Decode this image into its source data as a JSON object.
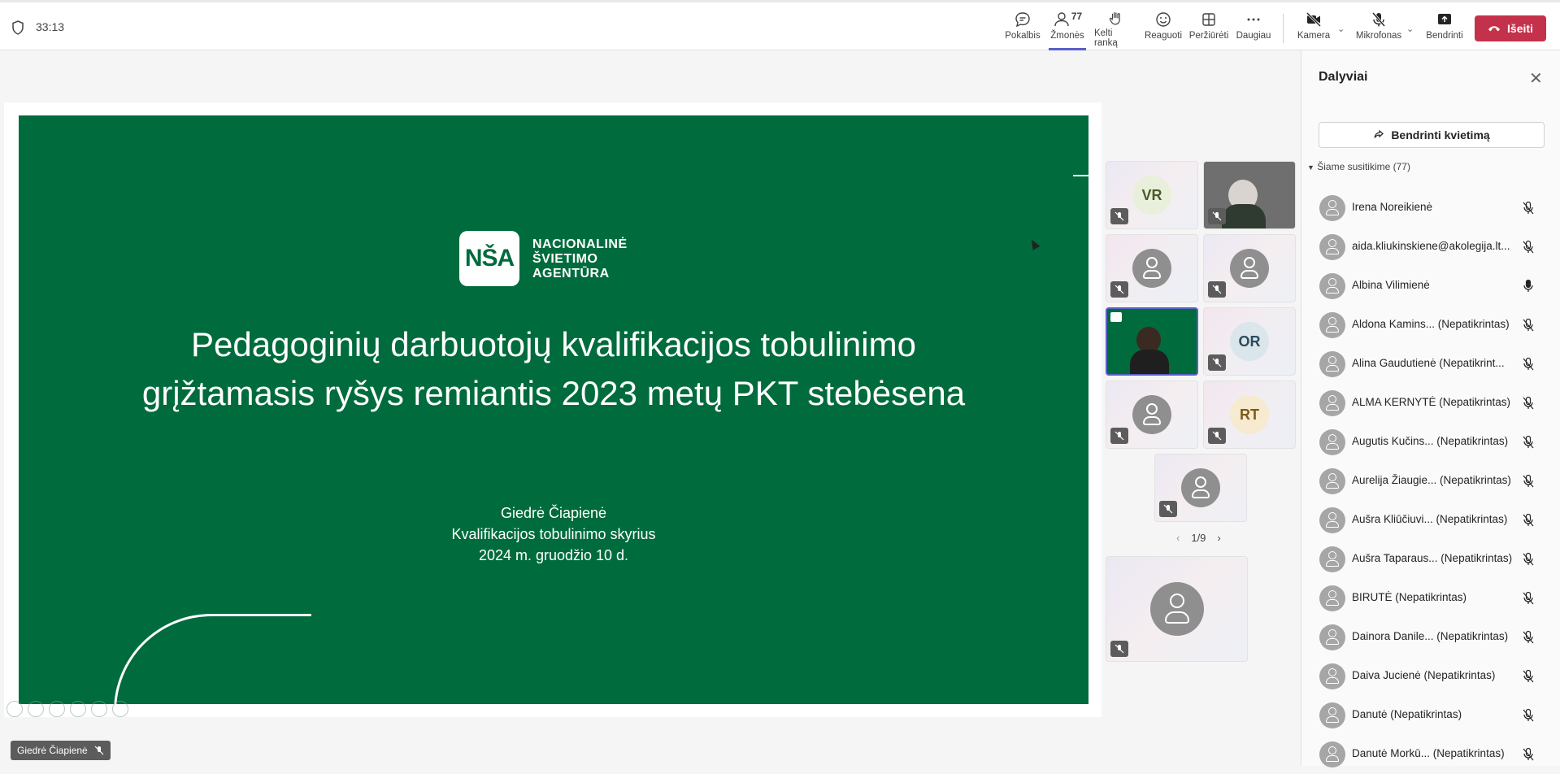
{
  "header": {
    "timer": "33:13",
    "toolbar": [
      {
        "label": "Pokalbis",
        "icon": "chat-icon"
      },
      {
        "label": "Žmonės",
        "icon": "people-icon",
        "count": "77",
        "active": true
      },
      {
        "label": "Kelti ranką",
        "icon": "raise-hand-icon"
      },
      {
        "label": "Reaguoti",
        "icon": "emoji-icon"
      },
      {
        "label": "Peržiūrėti",
        "icon": "view-grid-icon"
      },
      {
        "label": "Daugiau",
        "icon": "more-icon"
      },
      {
        "label": "Kamera",
        "icon": "camera-off-icon"
      },
      {
        "label": "Mikrofonas",
        "icon": "mic-off-icon"
      },
      {
        "label": "Bendrinti",
        "icon": "share-screen-icon"
      }
    ],
    "leave_label": "Išeiti"
  },
  "slide": {
    "logo_mark": "NŠA",
    "logo_line1": "NACIONALINĖ",
    "logo_line2": "ŠVIETIMO",
    "logo_line3": "AGENTŪRA",
    "title_line1": "Pedagoginių darbuotojų kvalifikacijos tobulinimo",
    "title_line2": "grįžtamasis ryšys remiantis 2023 metų PKT stebėsena",
    "author": "Giedrė Čiapienė",
    "department": "Kvalifikacijos tobulinimo skyrius",
    "date": "2024 m. gruodžio 10 d."
  },
  "gallery": {
    "tiles": [
      {
        "initials": "VR",
        "color": "#e8f0dc",
        "text_color": "#4a5a2a"
      },
      {
        "type": "video"
      },
      {
        "type": "avatar"
      },
      {
        "type": "avatar"
      },
      {
        "type": "presenter"
      },
      {
        "initials": "OR",
        "color": "#dbe6ec",
        "text_color": "#2c4a5c"
      },
      {
        "type": "avatar"
      },
      {
        "initials": "RT",
        "color": "#f6ead0",
        "text_color": "#7a5a1a"
      },
      {
        "type": "avatar"
      }
    ],
    "pager": "1/9"
  },
  "presenter_name": "Giedrė Čiapienė",
  "panel": {
    "title": "Dalyviai",
    "share_label": "Bendrinti kvietimą",
    "section_label": "Šiame susitikime (77)",
    "participants": [
      {
        "name": "Irena Noreikienė",
        "mic": "muted"
      },
      {
        "name": "aida.kliukinskiene@akolegija.lt...",
        "mic": "muted"
      },
      {
        "name": "Albina Vilimienė",
        "mic": "on"
      },
      {
        "name": "Aldona Kamins... (Nepatikrintas)",
        "mic": "muted"
      },
      {
        "name": "Alina Gaudutienė (Nepatikrint...",
        "mic": "muted"
      },
      {
        "name": "ALMA KERNYTĖ (Nepatikrintas)",
        "mic": "muted"
      },
      {
        "name": "Augutis Kučins... (Nepatikrintas)",
        "mic": "muted"
      },
      {
        "name": "Aurelija Žiaugie... (Nepatikrintas)",
        "mic": "muted"
      },
      {
        "name": "Aušra Kliūčiuvi... (Nepatikrintas)",
        "mic": "muted"
      },
      {
        "name": "Aušra Taparaus... (Nepatikrintas)",
        "mic": "muted"
      },
      {
        "name": "BIRUTĖ (Nepatikrintas)",
        "mic": "muted"
      },
      {
        "name": "Dainora Danile... (Nepatikrintas)",
        "mic": "muted"
      },
      {
        "name": "Daiva Jucienė (Nepatikrintas)",
        "mic": "muted"
      },
      {
        "name": "Danutė (Nepatikrintas)",
        "mic": "muted"
      },
      {
        "name": "Danutė Morkū... (Nepatikrintas)",
        "mic": "muted"
      }
    ]
  }
}
